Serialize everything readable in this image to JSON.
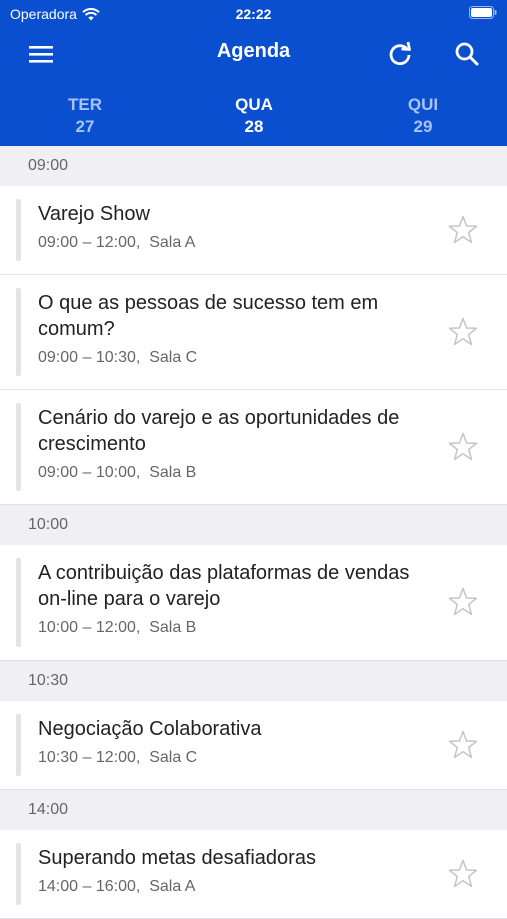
{
  "status": {
    "carrier": "Operadora",
    "time": "22:22"
  },
  "header": {
    "title": "Agenda"
  },
  "days": [
    {
      "dow": "TER",
      "num": "27"
    },
    {
      "dow": "QUA",
      "num": "28"
    },
    {
      "dow": "QUI",
      "num": "29"
    }
  ],
  "sections": [
    {
      "time": "09:00",
      "items": [
        {
          "title": "Varejo Show",
          "time": "09:00 – 12:00,",
          "room": "Sala A"
        },
        {
          "title": "O que as pessoas de sucesso tem em comum?",
          "time": "09:00 – 10:30,",
          "room": "Sala C"
        },
        {
          "title": "Cenário do varejo e as oportunidades de crescimento",
          "time": "09:00 – 10:00,",
          "room": "Sala B"
        }
      ]
    },
    {
      "time": "10:00",
      "items": [
        {
          "title": "A contribuição das plataformas de vendas on-line para o varejo",
          "time": "10:00 – 12:00,",
          "room": "Sala B"
        }
      ]
    },
    {
      "time": "10:30",
      "items": [
        {
          "title": "Negociação Colaborativa",
          "time": "10:30 – 12:00,",
          "room": "Sala C"
        }
      ]
    },
    {
      "time": "14:00",
      "items": [
        {
          "title": "Superando metas desafiadoras",
          "time": "14:00 – 16:00,",
          "room": "Sala A"
        }
      ]
    }
  ]
}
